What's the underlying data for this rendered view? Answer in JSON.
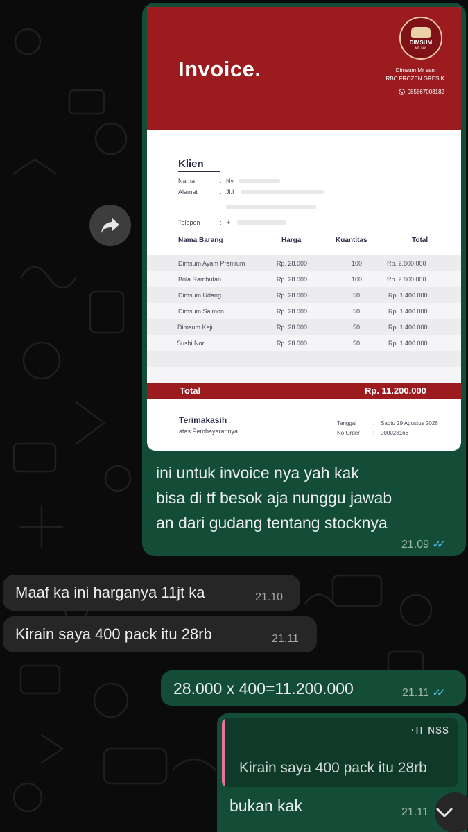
{
  "invoice": {
    "title": "Invoice.",
    "logo_text": "DIMSUM",
    "logo_sub": "MR. SAN",
    "shop_name": "Dimsum Mr san",
    "shop_sub": "RBC FROZEN GRESIK",
    "phone": "085867008182",
    "klien_heading": "Klien",
    "fields": {
      "nama_label": "Nama",
      "nama_value": "Ny",
      "alamat_label": "Alamat",
      "alamat_value": "Jl.I",
      "telepon_label": "Telepon",
      "telepon_value": "+"
    },
    "columns": [
      "Nama Barang",
      "Harga",
      "Kuantitas",
      "Total"
    ],
    "items": [
      {
        "name": "Dimsum Ayam Premium",
        "price": "Rp. 28.000",
        "qty": "100",
        "total": "Rp. 2.800.000"
      },
      {
        "name": "Bola Rambutan",
        "price": "Rp. 28.000",
        "qty": "100",
        "total": "Rp. 2.800.000"
      },
      {
        "name": "Dimsum Udang",
        "price": "Rp. 28.000",
        "qty": "50",
        "total": "Rp. 1.400.000"
      },
      {
        "name": "Dimsum Salmon",
        "price": "Rp. 28.000",
        "qty": "50",
        "total": "Rp. 1.400.000"
      },
      {
        "name": "Dimsum Keju",
        "price": "Rp. 28.000",
        "qty": "50",
        "total": "Rp. 1.400.000"
      },
      {
        "name": "Sushi Nori",
        "price": "Rp. 28.000",
        "qty": "50",
        "total": "Rp. 1.400.000"
      }
    ],
    "total_label": "Total",
    "total_value": "Rp. 11.200.000",
    "thanks": "Terimakasih",
    "thanks_sub": "atas Pembayarannya",
    "tanggal_label": "Tanggal",
    "tanggal_value": "Sabtu 29 Agustus 2026",
    "no_order_label": "No Order",
    "no_order_value": "000028166",
    "header_color": "#9c1b1f"
  },
  "messages": {
    "m1": {
      "line1": "ini untuk invoice nya yah kak",
      "line2": "bisa di tf besok aja nunggu jawab",
      "line3": "an dari gudang tentang stocknya",
      "time": "21.09",
      "ticks": "✓✓"
    },
    "m2": {
      "text": "Maaf ka ini harganya 11jt ka",
      "time": "21.10"
    },
    "m3": {
      "text": "Kirain saya 400 pack itu 28rb",
      "time": "21.11"
    },
    "m4": {
      "text": "28.000 x 400=11.200.000",
      "time": "21.11",
      "ticks": "✓✓"
    },
    "m5": {
      "quote_author": "·ıı ɴss",
      "quote_text": "Kirain saya 400 pack itu 28rb",
      "text": "bukan kak",
      "time": "21.11"
    }
  },
  "colors": {
    "outgoing": "#144d37",
    "incoming": "#262626",
    "read_ticks": "#53bdeb",
    "quote_bar": "#e9739d"
  }
}
